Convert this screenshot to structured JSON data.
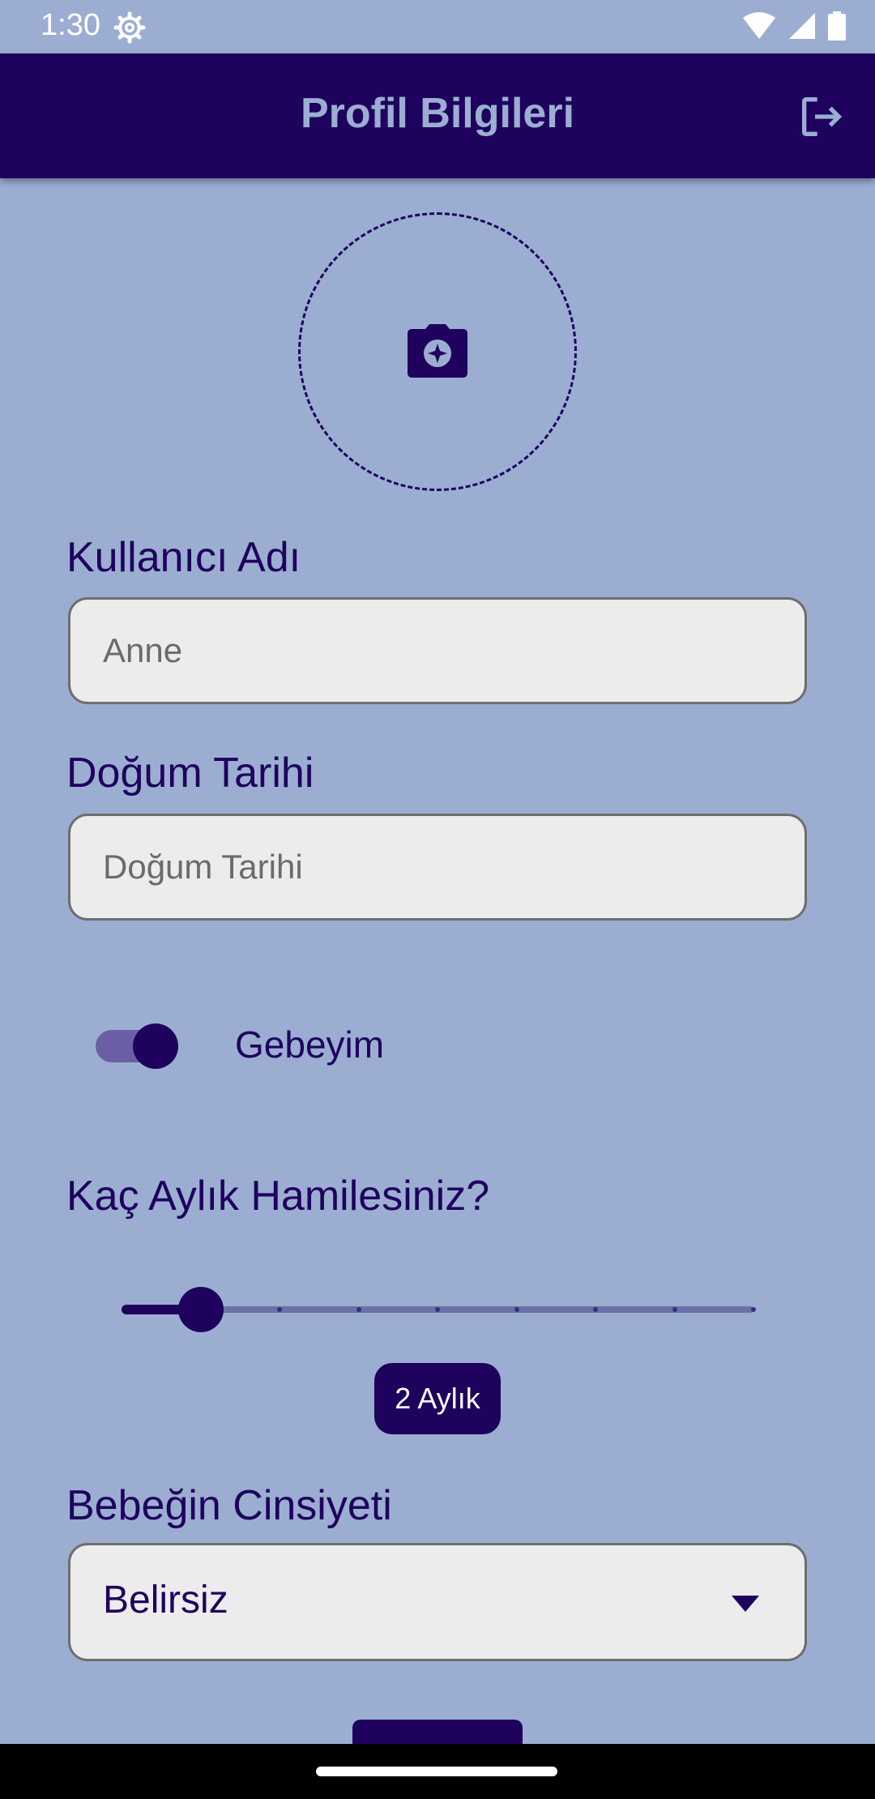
{
  "status_bar": {
    "time": "1:30",
    "icons": [
      "settings-gear-icon",
      "wifi-icon",
      "signal-icon",
      "battery-icon"
    ]
  },
  "app_bar": {
    "title": "Profil Bilgileri",
    "logout_icon": "logout-icon"
  },
  "avatar": {
    "icon": "camera-icon"
  },
  "form": {
    "username": {
      "label": "Kullanıcı Adı",
      "value": "",
      "placeholder": "Anne"
    },
    "birth_date": {
      "label": "Doğum Tarihi",
      "value": "",
      "placeholder": "Doğum Tarihi"
    },
    "pregnant": {
      "label": "Gebeyim",
      "checked": true
    },
    "pregnancy_month": {
      "label": "Kaç Aylık Hamilesiniz?",
      "min": 1,
      "max": 9,
      "value": 2,
      "value_label": "2 Aylık"
    },
    "baby_gender": {
      "label": "Bebeğin Cinsiyeti",
      "selected": "Belirsiz"
    }
  },
  "colors": {
    "background": "#9baed2",
    "primary": "#1f015e",
    "field_bg": "#ececec"
  }
}
